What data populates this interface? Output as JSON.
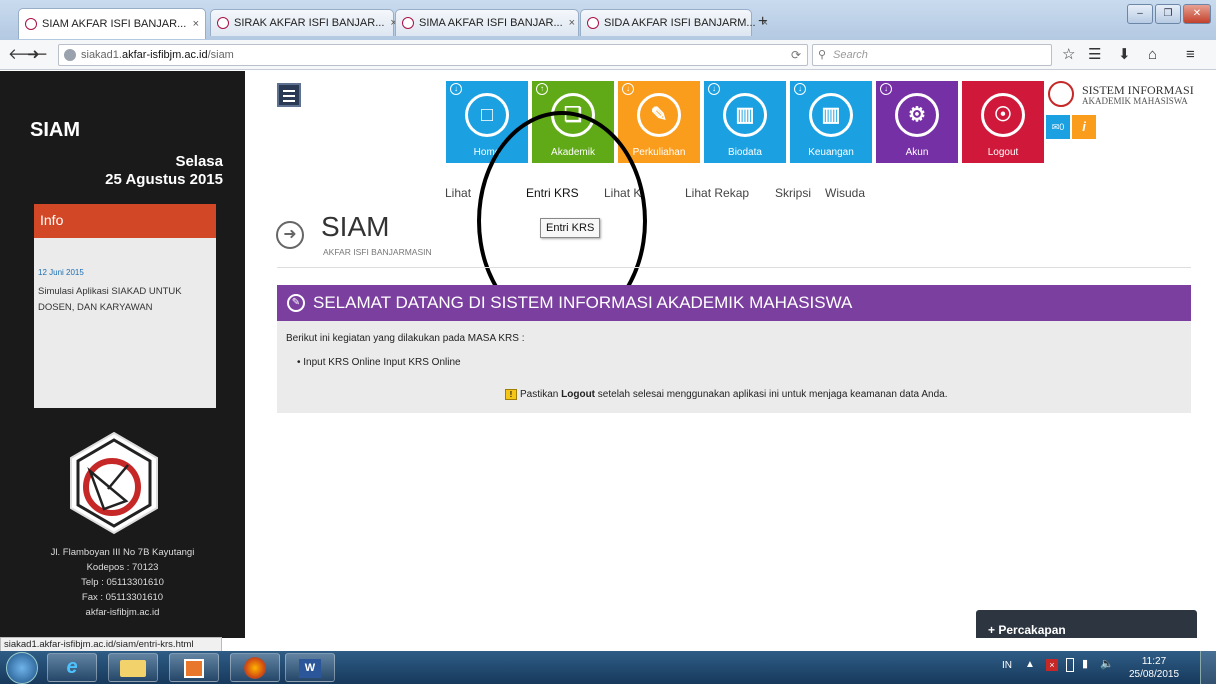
{
  "browser": {
    "tabs": [
      {
        "label": "SIAM AKFAR ISFI BANJAR...",
        "close": "×"
      },
      {
        "label": "SIRAK AKFAR ISFI BANJAR...",
        "close": "×"
      },
      {
        "label": "SIMA AKFAR ISFI BANJAR...",
        "close": "×"
      },
      {
        "label": "SIDA AKFAR ISFI BANJARM...",
        "close": "×"
      }
    ],
    "new_tab": "+",
    "url_prefix": "siakad1.",
    "url_domain": "akfar-isfibjm.ac.id",
    "url_path": "/siam",
    "search_placeholder": "Search",
    "status_url": "siakad1.akfar-isfibjm.ac.id/siam/entri-krs.html"
  },
  "sidebar": {
    "app_name": "SIAM",
    "day": "Selasa",
    "date": "25 Agustus 2015",
    "info_title": "Info",
    "info_date": "12 Juni 2015",
    "info_text": "Simulasi Aplikasi SIAKAD UNTUK DOSEN, DAN KARYAWAN",
    "address": [
      "Jl. Flamboyan III No 7B Kayutangi",
      "Kodepos : 70123",
      "Telp : 05113301610",
      "Fax : 05113301610",
      "akfar-isfibjm.ac.id"
    ]
  },
  "tiles": [
    {
      "label": "Home",
      "color": "#1ba1e2"
    },
    {
      "label": "Akademik",
      "color": "#60a917"
    },
    {
      "label": "Perkuliahan",
      "color": "#fa9c1c"
    },
    {
      "label": "Biodata",
      "color": "#1ba1e2"
    },
    {
      "label": "Keuangan",
      "color": "#1ba1e2"
    },
    {
      "label": "Akun",
      "color": "#7630a5"
    },
    {
      "label": "Logout",
      "color": "#d0193a"
    }
  ],
  "brand": {
    "title": "SISTEM INFORMASI",
    "subtitle": "AKADEMIK MAHASISWA",
    "mail_count": "0",
    "info_glyph": "i"
  },
  "submenu": [
    "Lihat KRS",
    "Entri KRS",
    "Lihat KHS",
    "Lihat Rekap",
    "Skripsi",
    "Wisuda"
  ],
  "submenu_visible": [
    "Lihat ",
    "Entri KRS",
    "Lihat K",
    "Lihat Rekap",
    "Skripsi",
    "Wisuda"
  ],
  "tooltip": "Entri KRS",
  "page": {
    "title": "SIAM",
    "subtitle": "AKFAR ISFI BANJARMASIN",
    "banner": "SELAMAT DATANG DI SISTEM INFORMASI AKADEMIK MAHASISWA",
    "banner_color": "#7b3fa0",
    "intro": "Berikut ini kegiatan yang dilakukan pada MASA KRS :",
    "bullet": "Input KRS Online Input KRS Online",
    "note_pre": "Pastikan ",
    "note_bold": "Logout",
    "note_post": " setelah selesai menggunakan aplikasi ini untuk menjaga keamanan data Anda."
  },
  "chat": {
    "label": "+ Percakapan"
  },
  "taskbar": {
    "lang": "IN",
    "time": "11:27",
    "date": "25/08/2015"
  }
}
